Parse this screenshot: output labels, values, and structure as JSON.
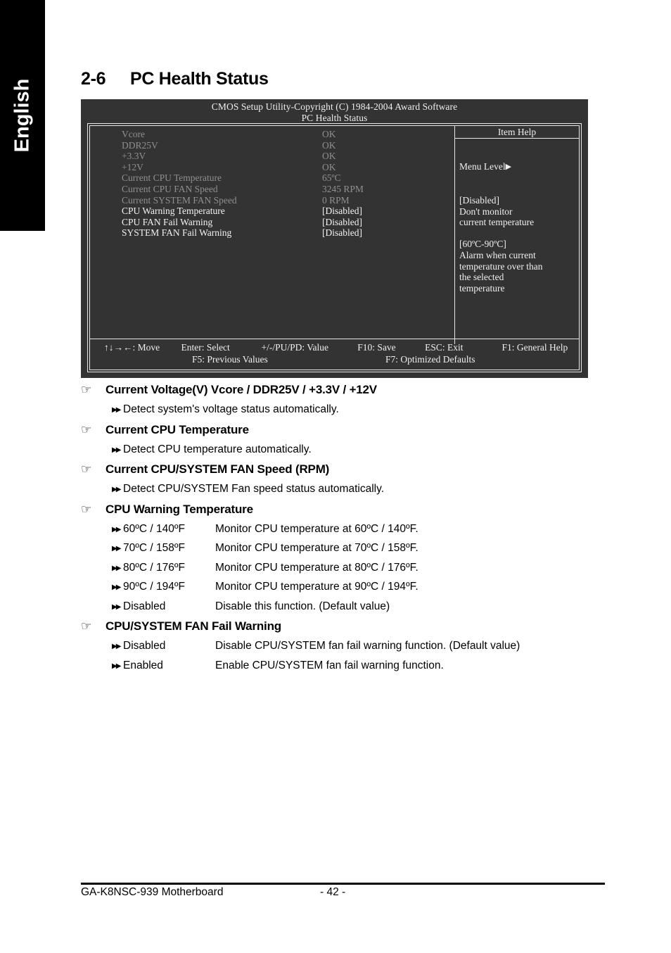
{
  "sidebar": {
    "language_tab": "English"
  },
  "section": {
    "number": "2-6",
    "title": "PC Health Status"
  },
  "bios": {
    "title_line1": "CMOS Setup Utility-Copyright (C) 1984-2004 Award Software",
    "title_line2": "PC Health Status",
    "settings": [
      {
        "label": "Vcore",
        "value": "OK",
        "state": "dim"
      },
      {
        "label": "DDR25V",
        "value": "OK",
        "state": "dim"
      },
      {
        "label": "+3.3V",
        "value": "OK",
        "state": "dim"
      },
      {
        "label": "+12V",
        "value": "OK",
        "state": "dim"
      },
      {
        "label": "Current CPU Temperature",
        "value": "65ºC",
        "state": "dim"
      },
      {
        "label": "Current CPU FAN Speed",
        "value": "3245 RPM",
        "state": "dim"
      },
      {
        "label": "Current SYSTEM FAN Speed",
        "value": "0      RPM",
        "state": "dim"
      },
      {
        "label": "CPU Warning Temperature",
        "value": "[Disabled]",
        "state": "bright"
      },
      {
        "label": "CPU FAN Fail Warning",
        "value": "[Disabled]",
        "state": "bright"
      },
      {
        "label": "SYSTEM FAN Fail Warning",
        "value": "[Disabled]",
        "state": "bright"
      }
    ],
    "item_help": {
      "title": "Item Help",
      "menu_level": "Menu Level",
      "menu_level_arrow": "▶",
      "body": "[Disabled]\nDon't monitor\ncurrent temperature\n\n[60ºC-90ºC]\nAlarm when current\ntemperature over than\nthe selected\ntemperature"
    },
    "footer": {
      "move": "↑↓→←: Move",
      "enter": "Enter: Select",
      "value": "+/-/PU/PD: Value",
      "save": "F10: Save",
      "exit": "ESC: Exit",
      "general_help": "F1: General Help",
      "previous_values": "F5: Previous Values",
      "optimized_defaults": "F7: Optimized Defaults"
    }
  },
  "explanations": [
    {
      "heading": "Current Voltage(V) Vcore / DDR25V / +3.3V / +12V",
      "rows": [
        {
          "single": "Detect system's voltage status automatically."
        }
      ]
    },
    {
      "heading": "Current CPU Temperature",
      "rows": [
        {
          "single": "Detect CPU temperature automatically."
        }
      ]
    },
    {
      "heading": "Current CPU/SYSTEM FAN Speed (RPM)",
      "rows": [
        {
          "single": "Detect CPU/SYSTEM Fan speed status automatically."
        }
      ]
    },
    {
      "heading": "CPU Warning Temperature",
      "rows": [
        {
          "term": "60ºC / 140ºF",
          "desc": "Monitor CPU temperature at 60ºC / 140ºF."
        },
        {
          "term": "70ºC / 158ºF",
          "desc": "Monitor CPU temperature at 70ºC / 158ºF."
        },
        {
          "term": "80ºC / 176ºF",
          "desc": "Monitor CPU temperature at 80ºC / 176ºF."
        },
        {
          "term": "90ºC / 194ºF",
          "desc": "Monitor CPU temperature at 90ºC / 194ºF."
        },
        {
          "term": "Disabled",
          "desc": "Disable this function. (Default value)"
        }
      ]
    },
    {
      "heading": "CPU/SYSTEM FAN Fail Warning",
      "rows": [
        {
          "term": "Disabled",
          "desc": "Disable CPU/SYSTEM fan fail warning function. (Default value)"
        },
        {
          "term": "Enabled",
          "desc": "Enable CPU/SYSTEM fan fail warning function."
        }
      ]
    }
  ],
  "page_footer": {
    "product": "GA-K8NSC-939 Motherboard",
    "page_number": "- 42 -"
  },
  "icons": {
    "hand_pointer": "☞",
    "double_arrow": "▶▶"
  },
  "colors": {
    "bios_background": "#333333",
    "bios_text_bright": "#f2f2f2",
    "bios_text_dim": "#8f8f8f",
    "sidebar_tab": "#000000",
    "page_background": "#ffffff"
  }
}
